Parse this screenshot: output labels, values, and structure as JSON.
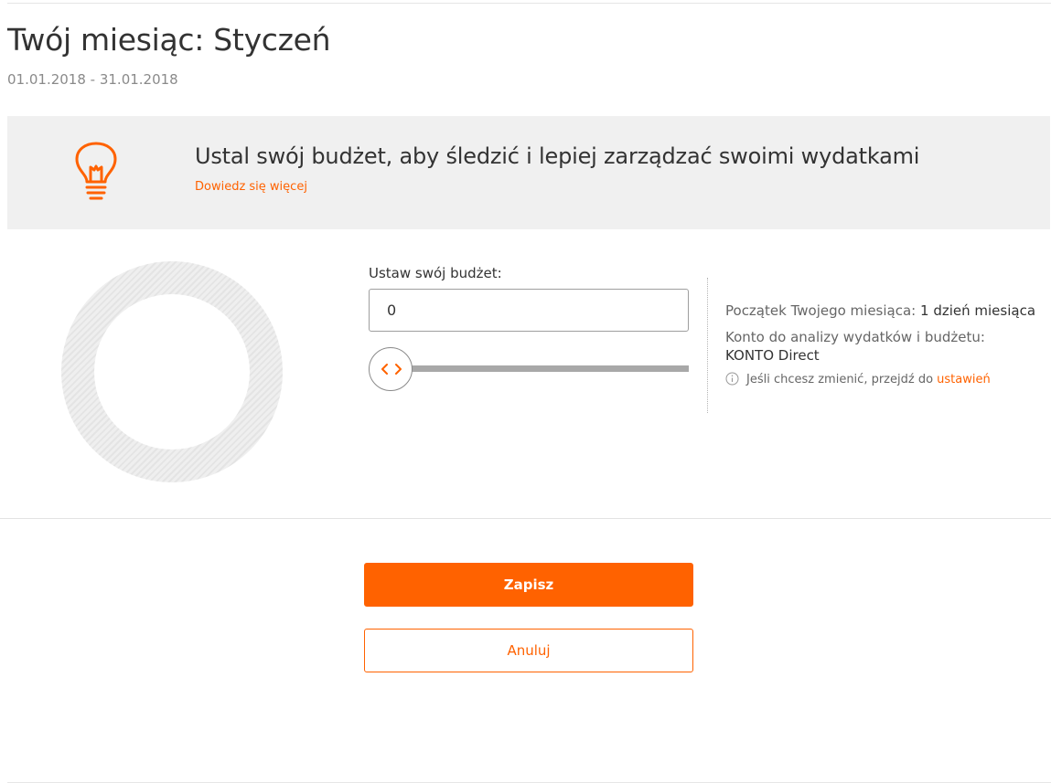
{
  "header": {
    "title": "Twój miesiąc: Styczeń",
    "date_range": "01.01.2018 - 31.01.2018"
  },
  "tip": {
    "icon": "lightbulb-icon",
    "text": "Ustal swój budżet, aby śledzić i lepiej zarządzać swoimi wydatkami",
    "link": "Dowiedz się więcej"
  },
  "budget": {
    "label": "Ustaw swój budżet:",
    "value": "0",
    "slider_value": 0,
    "slider_icon": "chevrons-left-right-icon"
  },
  "info": {
    "month_start_label": "Początek Twojego miesiąca:",
    "month_start_value": "1 dzień miesiąca",
    "account_label": "Konto do analizy wydatków i budżetu:",
    "account_value": "KONTO Direct",
    "hint_icon": "info-icon",
    "hint_text": "Jeśli chcesz zmienić, przejdź do",
    "hint_link": "ustawień"
  },
  "actions": {
    "save": "Zapisz",
    "cancel": "Anuluj"
  },
  "colors": {
    "accent": "#ff6200",
    "banner_bg": "#f0f0f0"
  }
}
